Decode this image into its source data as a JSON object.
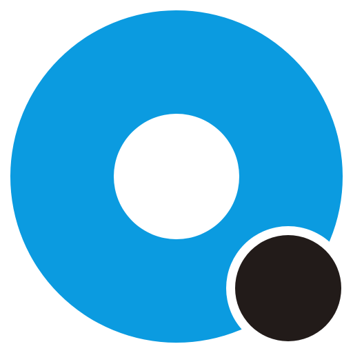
{
  "logo": {
    "icon_name": "ring-with-dot-logo-icon",
    "colors": {
      "background": "#ffffff",
      "ring": "#0b9be0",
      "inner_hole": "#ffffff",
      "dot": "#221b19",
      "dot_outline": "#ffffff"
    }
  }
}
